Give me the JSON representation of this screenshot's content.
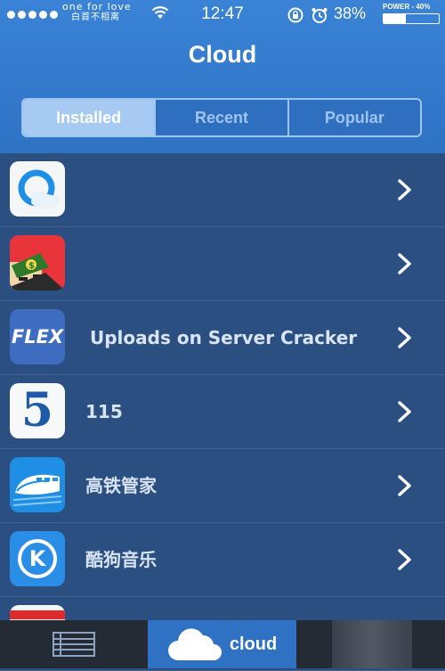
{
  "status_bar": {
    "carrier_line1": "one for love",
    "carrier_line2": "白首不相离",
    "time": "12:47",
    "battery_percent": "38%",
    "power_label": "POWER - 40%",
    "power_level": 0.4
  },
  "header": {
    "title": "Cloud"
  },
  "segments": [
    {
      "label": "Installed",
      "active": true
    },
    {
      "label": "Recent",
      "active": false
    },
    {
      "label": "Popular",
      "active": false
    }
  ],
  "apps": [
    {
      "label": "",
      "icon": "qq-browser-icon"
    },
    {
      "label": "",
      "icon": "green-cap-character-icon"
    },
    {
      "label": "Uploads on Server Cracker",
      "icon": "flex-icon",
      "icon_text": "FLEX"
    },
    {
      "label": "115",
      "icon": "app-115-icon",
      "icon_text": "5"
    },
    {
      "label": "高铁管家",
      "icon": "train-icon"
    },
    {
      "label": "酷狗音乐",
      "icon": "kugou-icon",
      "icon_text": "K"
    }
  ],
  "tabbar": {
    "list_icon": "list-icon",
    "cloud_label": "cloud",
    "cloud_icon": "cloud-icon"
  },
  "colors": {
    "header_blue": "#3a83d6",
    "list_bg": "#2c4f82",
    "tabbar_bg": "#252b35",
    "active_tab": "#2f72c4"
  }
}
